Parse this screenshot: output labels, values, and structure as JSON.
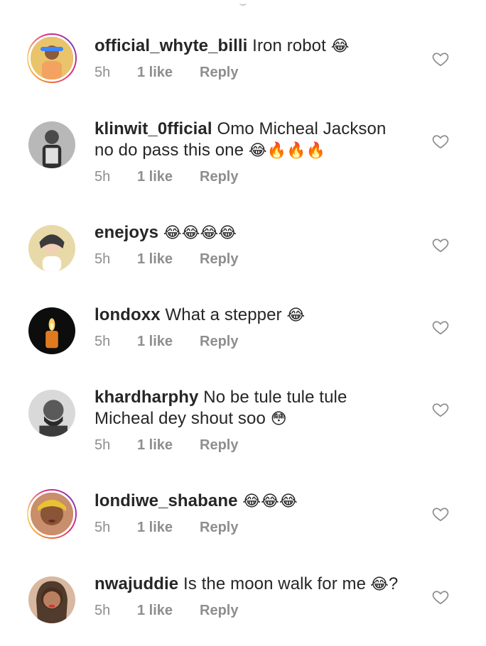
{
  "comments": [
    {
      "username": "official_whyte_billi",
      "text": "Iron robot",
      "emoji": "😂",
      "time": "5h",
      "likes": "1 like",
      "reply": "Reply",
      "avatar_ring": true
    },
    {
      "username": "klinwit_0fficial",
      "text": "Omo Micheal Jackson no do pass this one",
      "emoji": "😂🔥🔥🔥",
      "time": "5h",
      "likes": "1 like",
      "reply": "Reply",
      "avatar_ring": false
    },
    {
      "username": "enejoys",
      "text": "",
      "emoji": "😂😂😂😂",
      "time": "5h",
      "likes": "1 like",
      "reply": "Reply",
      "avatar_ring": false
    },
    {
      "username": "londoxx",
      "text": "What a stepper",
      "emoji": "😂",
      "time": "5h",
      "likes": "1 like",
      "reply": "Reply",
      "avatar_ring": false
    },
    {
      "username": "khardharphy",
      "text": "No be tule tule tule Micheal dey shout soo",
      "emoji": "😳",
      "time": "5h",
      "likes": "1 like",
      "reply": "Reply",
      "avatar_ring": false
    },
    {
      "username": "londiwe_shabane",
      "text": "",
      "emoji": "😂😂😂",
      "time": "5h",
      "likes": "1 like",
      "reply": "Reply",
      "avatar_ring": true
    },
    {
      "username": "nwajuddie",
      "text": "Is the moon walk for me",
      "emoji": "😂",
      "suffix": "?",
      "time": "5h",
      "likes": "1 like",
      "reply": "Reply",
      "avatar_ring": false
    }
  ],
  "icons": {
    "like": "heart-outline-icon"
  },
  "colors": {
    "username": "#262626",
    "meta": "#8e8e8e",
    "heart_stroke": "#8e8e8e"
  }
}
